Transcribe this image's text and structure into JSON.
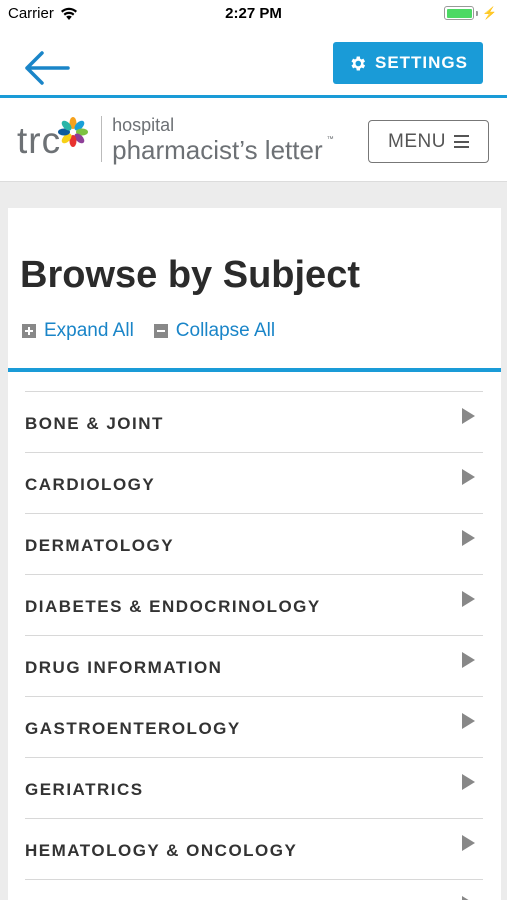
{
  "status_bar": {
    "carrier": "Carrier",
    "time": "2:27 PM",
    "battery_level": 1.0
  },
  "nav": {
    "back_icon": "arrow-left-icon",
    "settings_label": "SETTINGS",
    "settings_icon": "gear-icon",
    "accent_color": "#1a9bd7"
  },
  "brand": {
    "logo_mark": "trc",
    "logo_line1": "hospital",
    "logo_line2": "pharmacist’s letter",
    "trademark": "™",
    "menu_label": "MENU"
  },
  "content": {
    "title": "Browse by Subject",
    "expand_all": "Expand All",
    "collapse_all": "Collapse All",
    "link_color": "#1a85c8",
    "subjects": [
      "BONE & JOINT",
      "CARDIOLOGY",
      "DERMATOLOGY",
      "DIABETES & ENDOCRINOLOGY",
      "DRUG INFORMATION",
      "GASTROENTEROLOGY",
      "GERIATRICS",
      "HEMATOLOGY & ONCOLOGY"
    ]
  }
}
